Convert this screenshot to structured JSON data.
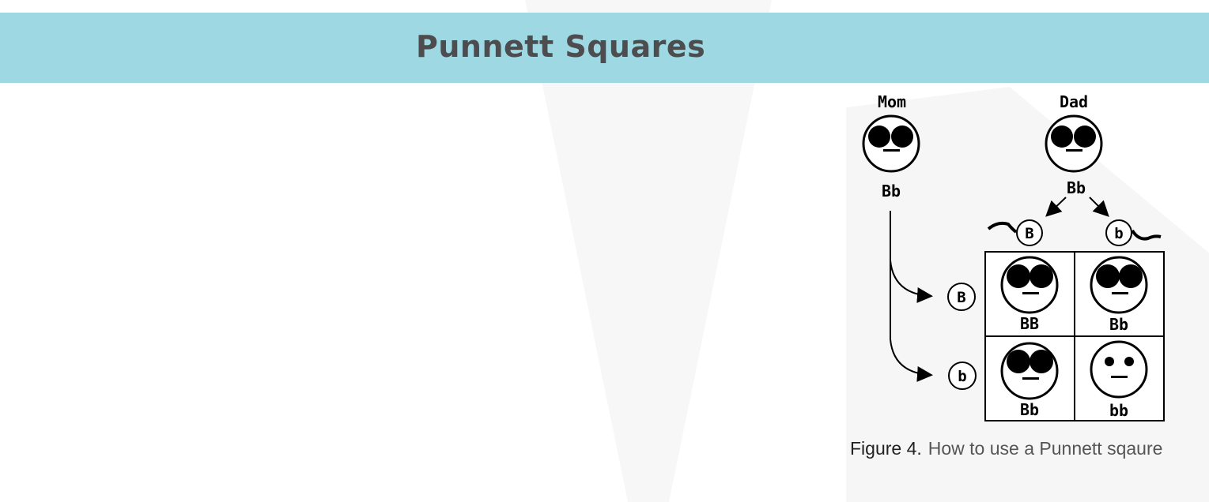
{
  "header": {
    "title": "Punnett Squares"
  },
  "figure": {
    "mom": {
      "label": "Mom",
      "genotype": "Bb"
    },
    "dad": {
      "label": "Dad",
      "genotype": "Bb"
    },
    "dad_alleles": [
      "B",
      "b"
    ],
    "mom_alleles": [
      "B",
      "b"
    ],
    "grid": [
      [
        "BB",
        "Bb"
      ],
      [
        "Bb",
        "bb"
      ]
    ],
    "caption": {
      "label": "Figure 4.",
      "text": "How to use a Punnett sqaure"
    }
  },
  "colors": {
    "header_bg": "#9dd8e3",
    "title_text": "#4d4d4f"
  }
}
